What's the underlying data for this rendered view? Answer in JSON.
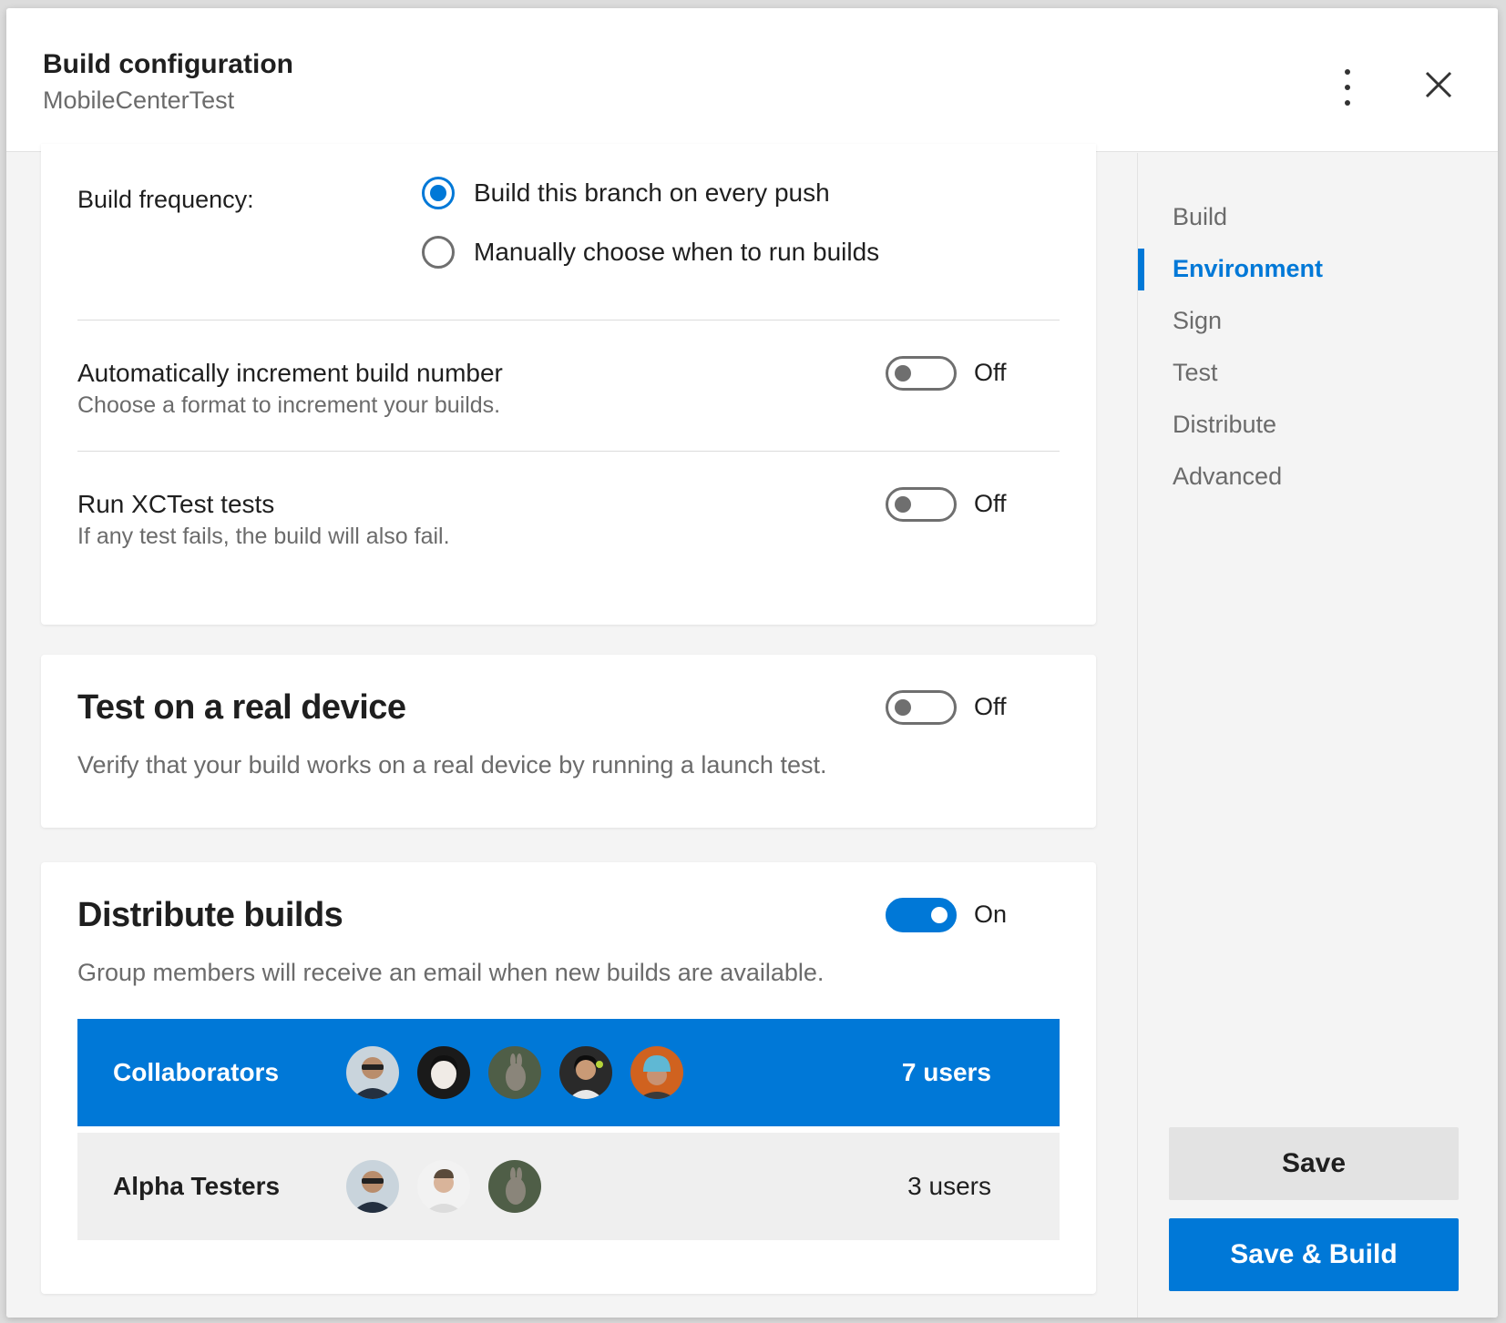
{
  "header": {
    "title": "Build configuration",
    "subtitle": "MobileCenterTest"
  },
  "build_frequency": {
    "label": "Build frequency:",
    "options": [
      {
        "label": "Build this branch on every push",
        "selected": true
      },
      {
        "label": "Manually choose when to run builds",
        "selected": false
      }
    ]
  },
  "settings": {
    "auto_increment": {
      "title": "Automatically increment build number",
      "subtitle": "Choose a format to increment your builds.",
      "state": "Off"
    },
    "xctest": {
      "title": "Run XCTest tests",
      "subtitle": "If any test fails, the build will also fail.",
      "state": "Off"
    }
  },
  "real_device": {
    "heading": "Test on a real device",
    "description": "Verify that your build works on a real device by running a launch test.",
    "state": "Off"
  },
  "distribute": {
    "heading": "Distribute builds",
    "description": "Group members will receive an email when new builds are available.",
    "state": "On",
    "groups": [
      {
        "name": "Collaborators",
        "count": "7 users",
        "selected": true,
        "avatars": [
          "avatar-1",
          "avatar-2",
          "avatar-3",
          "avatar-4",
          "avatar-5"
        ]
      },
      {
        "name": "Alpha Testers",
        "count": "3 users",
        "selected": false,
        "avatars": [
          "avatar-1",
          "avatar-6",
          "avatar-3"
        ]
      }
    ]
  },
  "sidenav": {
    "items": [
      {
        "label": "Build",
        "active": false
      },
      {
        "label": "Environment",
        "active": true
      },
      {
        "label": "Sign",
        "active": false
      },
      {
        "label": "Test",
        "active": false
      },
      {
        "label": "Distribute",
        "active": false
      },
      {
        "label": "Advanced",
        "active": false
      }
    ]
  },
  "actions": {
    "save_label": "Save",
    "save_build_label": "Save & Build"
  },
  "colors": {
    "accent": "#0078d7",
    "background": "#f4f4f4",
    "card": "#ffffff"
  }
}
